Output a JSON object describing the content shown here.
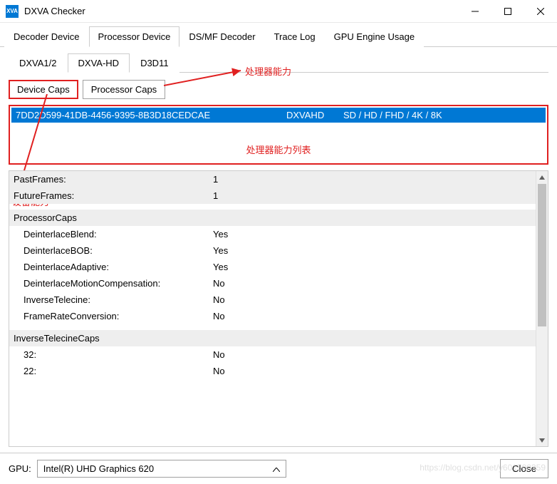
{
  "app": {
    "icon_text": "XVA",
    "title": "DXVA Checker"
  },
  "main_tabs": [
    {
      "label": "Decoder Device",
      "active": false
    },
    {
      "label": "Processor Device",
      "active": true
    },
    {
      "label": "DS/MF Decoder",
      "active": false
    },
    {
      "label": "Trace Log",
      "active": false
    },
    {
      "label": "GPU Engine Usage",
      "active": false
    }
  ],
  "sub_tabs": [
    {
      "label": "DXVA1/2",
      "active": false
    },
    {
      "label": "DXVA-HD",
      "active": true
    },
    {
      "label": "D3D11",
      "active": false
    }
  ],
  "caps_buttons": {
    "device": "Device Caps",
    "processor": "Processor Caps"
  },
  "annotations": {
    "processor_caps": "处理器能力",
    "list_caption": "处理器能力列表",
    "device_caps": "设备能力"
  },
  "list_row": {
    "guid": "7DD2D599-41DB-4456-9395-8B3D18CEDCAE",
    "api": "DXVAHD",
    "res": "SD / HD / FHD / 4K / 8K"
  },
  "grid": {
    "rows": [
      {
        "key": "PastFrames:",
        "val": "1",
        "header": true
      },
      {
        "key": "FutureFrames:",
        "val": "1",
        "header": true
      },
      {
        "key": "",
        "val": "",
        "header": false
      },
      {
        "key": "ProcessorCaps",
        "val": "",
        "header": true
      },
      {
        "key": "DeinterlaceBlend:",
        "val": "Yes",
        "header": false,
        "indent": true
      },
      {
        "key": "DeinterlaceBOB:",
        "val": "Yes",
        "header": false,
        "indent": true
      },
      {
        "key": "DeinterlaceAdaptive:",
        "val": "Yes",
        "header": false,
        "indent": true
      },
      {
        "key": "DeinterlaceMotionCompensation:",
        "val": "No",
        "header": false,
        "indent": true
      },
      {
        "key": "InverseTelecine:",
        "val": "No",
        "header": false,
        "indent": true
      },
      {
        "key": "FrameRateConversion:",
        "val": "No",
        "header": false,
        "indent": true
      },
      {
        "key": "",
        "val": "",
        "header": false
      },
      {
        "key": "InverseTelecineCaps",
        "val": "",
        "header": true
      },
      {
        "key": "32:",
        "val": "No",
        "header": false,
        "indent": true
      },
      {
        "key": "22:",
        "val": "No",
        "header": false,
        "indent": true
      }
    ]
  },
  "footer": {
    "gpu_label": "GPU:",
    "gpu_selected": "Intel(R) UHD Graphics 620",
    "close": "Close"
  },
  "watermark": "https://blog.csdn.net/y601500359"
}
